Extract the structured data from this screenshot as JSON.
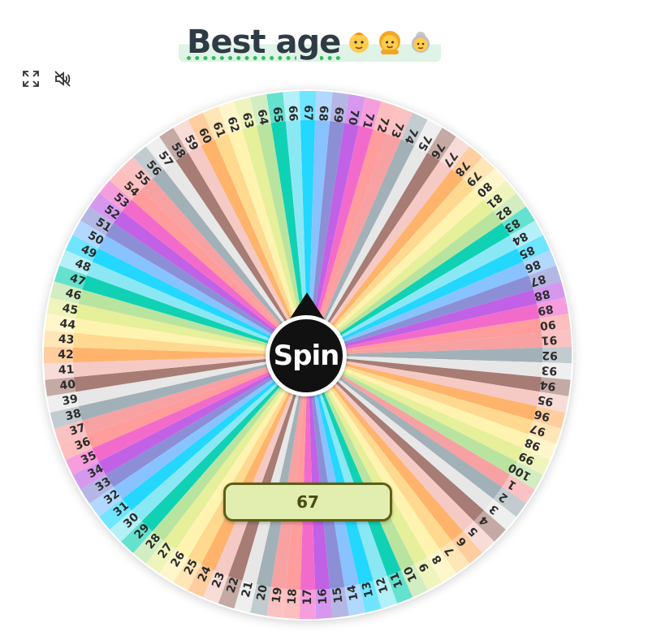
{
  "header": {
    "title": "Best age",
    "emojis": [
      "baby-emoji-icon",
      "woman-emoji-icon",
      "old-woman-emoji-icon"
    ]
  },
  "toolbar": {
    "fullscreen_icon": "fullscreen-icon",
    "mute_icon": "speaker-muted-icon"
  },
  "wheel": {
    "segments": [
      "1",
      "2",
      "3",
      "4",
      "5",
      "6",
      "7",
      "8",
      "9",
      "10",
      "11",
      "12",
      "13",
      "14",
      "15",
      "16",
      "17",
      "18",
      "19",
      "20",
      "21",
      "22",
      "23",
      "24",
      "25",
      "26",
      "27",
      "28",
      "29",
      "30",
      "31",
      "32",
      "33",
      "34",
      "35",
      "36",
      "37",
      "38",
      "39",
      "40",
      "41",
      "42",
      "43",
      "44",
      "45",
      "46",
      "47",
      "48",
      "49",
      "50",
      "51",
      "52",
      "53",
      "54",
      "55",
      "56",
      "57",
      "58",
      "59",
      "60",
      "61",
      "62",
      "63",
      "64",
      "65",
      "66",
      "67",
      "68",
      "69",
      "70",
      "71",
      "72",
      "73",
      "74",
      "75",
      "76",
      "77",
      "78",
      "79",
      "80",
      "81",
      "82",
      "83",
      "84",
      "85",
      "86",
      "87",
      "88",
      "89",
      "90",
      "91",
      "92",
      "93",
      "94",
      "95",
      "96",
      "97",
      "98",
      "99",
      "100"
    ],
    "palette": [
      "#f7a1a3",
      "#a2b1b7",
      "#e7e7e7",
      "#a67c74",
      "#f5c9c4",
      "#ffb36b",
      "#ffd98f",
      "#fff3b0",
      "#e6ef9a",
      "#b9e4a0",
      "#11d1b5",
      "#8ae8f4",
      "#23d7ff",
      "#89c3ff",
      "#8c8fd6",
      "#c161e6",
      "#f26bcb",
      "#ff9c9c"
    ],
    "spin_label": "Spin"
  },
  "result": {
    "value": "67"
  }
}
